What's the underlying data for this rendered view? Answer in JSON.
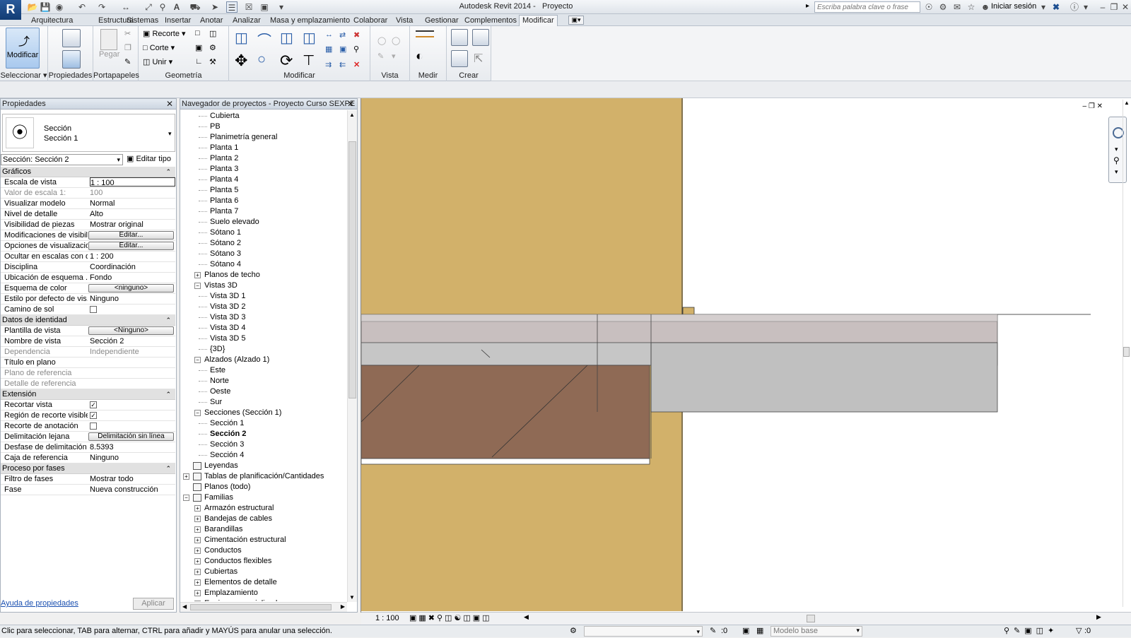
{
  "app": {
    "title": "Autodesk Revit 2014 -",
    "project": "Proyecto",
    "search_placeholder": "Escriba palabra clave o frase",
    "login": "Iniciar sesión"
  },
  "tabs": [
    "Arquitectura",
    "Estructura",
    "Sistemas",
    "Insertar",
    "Anotar",
    "Analizar",
    "Masa y emplazamiento",
    "Colaborar",
    "Vista",
    "Gestionar",
    "Complementos",
    "Modificar"
  ],
  "ribbon": {
    "modify_label": "Modificar",
    "paste_label": "Pegar",
    "cut_label": "Recorte",
    "corte_label": "Corte",
    "join_label": "Unir",
    "panels": [
      "Seleccionar",
      "Propiedades",
      "Portapapeles",
      "Geometría",
      "Modificar",
      "Vista",
      "Medir",
      "Crear"
    ]
  },
  "properties": {
    "title": "Propiedades",
    "type_name": "Sección",
    "type_sub": "Sección 1",
    "instance": "Sección: Sección 2",
    "edit_type": "Editar tipo",
    "categories": {
      "graphics": "Gráficos",
      "identity": "Datos de identidad",
      "extents": "Extensión",
      "phasing": "Proceso por fases"
    },
    "rows": {
      "scale": {
        "k": "Escala de vista",
        "v": "1 : 100"
      },
      "scale_value": {
        "k": "Valor de escala    1:",
        "v": "100"
      },
      "display_model": {
        "k": "Visualizar modelo",
        "v": "Normal"
      },
      "detail_level": {
        "k": "Nivel de detalle",
        "v": "Alto"
      },
      "parts": {
        "k": "Visibilidad de piezas",
        "v": "Mostrar original"
      },
      "vg": {
        "k": "Modificaciones de visibili...",
        "v": "Editar..."
      },
      "graphic_opts": {
        "k": "Opciones de visualizació...",
        "v": "Editar..."
      },
      "hide_scale": {
        "k": "Ocultar en escalas con d...",
        "v": "1 : 200"
      },
      "discipline": {
        "k": "Disciplina",
        "v": "Coordinación"
      },
      "color_loc": {
        "k": "Ubicación de esquema ...",
        "v": "Fondo"
      },
      "color_scheme": {
        "k": "Esquema de color",
        "v": "<ninguno>"
      },
      "analysis": {
        "k": "Estilo por defecto de vis...",
        "v": "Ninguno"
      },
      "sun_path": {
        "k": "Camino de sol",
        "v": ""
      },
      "template": {
        "k": "Plantilla de vista",
        "v": "<Ninguno>"
      },
      "view_name": {
        "k": "Nombre de vista",
        "v": "Sección 2"
      },
      "dependency": {
        "k": "Dependencia",
        "v": "Independiente"
      },
      "title_on_sheet": {
        "k": "Título en plano",
        "v": ""
      },
      "ref_sheet": {
        "k": "Plano de referencia",
        "v": ""
      },
      "ref_detail": {
        "k": "Detalle de referencia",
        "v": ""
      },
      "crop_view": {
        "k": "Recortar vista",
        "v": ""
      },
      "crop_visible": {
        "k": "Región de recorte visible",
        "v": ""
      },
      "annot_crop": {
        "k": "Recorte de anotación",
        "v": ""
      },
      "far_clip": {
        "k": "Delimitación lejana",
        "v": "Delimitación sin línea"
      },
      "far_offset": {
        "k": "Desfase de delimitación ...",
        "v": "8.5393"
      },
      "scope_box": {
        "k": "Caja de referencia",
        "v": "Ninguno"
      },
      "phase_filter": {
        "k": "Filtro de fases",
        "v": "Mostrar todo"
      },
      "phase": {
        "k": "Fase",
        "v": "Nueva construcción"
      }
    },
    "help": "Ayuda de propiedades",
    "apply": "Aplicar"
  },
  "browser": {
    "title": "Navegador de proyectos - Proyecto Curso SEXPE",
    "items": [
      {
        "label": "Cubierta",
        "lvl": 2
      },
      {
        "label": "PB",
        "lvl": 2
      },
      {
        "label": "Planimetría general",
        "lvl": 2
      },
      {
        "label": "Planta 1",
        "lvl": 2
      },
      {
        "label": "Planta 2",
        "lvl": 2
      },
      {
        "label": "Planta 3",
        "lvl": 2
      },
      {
        "label": "Planta 4",
        "lvl": 2
      },
      {
        "label": "Planta 5",
        "lvl": 2
      },
      {
        "label": "Planta 6",
        "lvl": 2
      },
      {
        "label": "Planta 7",
        "lvl": 2
      },
      {
        "label": "Suelo elevado",
        "lvl": 2
      },
      {
        "label": "Sótano 1",
        "lvl": 2
      },
      {
        "label": "Sótano 2",
        "lvl": 2
      },
      {
        "label": "Sótano 3",
        "lvl": 2
      },
      {
        "label": "Sótano 4",
        "lvl": 2
      },
      {
        "label": "Planos de techo",
        "lvl": 1,
        "exp": "+"
      },
      {
        "label": "Vistas 3D",
        "lvl": 1,
        "exp": "-"
      },
      {
        "label": "Vista 3D 1",
        "lvl": 2
      },
      {
        "label": "Vista 3D 2",
        "lvl": 2
      },
      {
        "label": "Vista 3D 3",
        "lvl": 2
      },
      {
        "label": "Vista 3D 4",
        "lvl": 2
      },
      {
        "label": "Vista 3D 5",
        "lvl": 2
      },
      {
        "label": "{3D}",
        "lvl": 2
      },
      {
        "label": "Alzados (Alzado 1)",
        "lvl": 1,
        "exp": "-"
      },
      {
        "label": "Este",
        "lvl": 2
      },
      {
        "label": "Norte",
        "lvl": 2
      },
      {
        "label": "Oeste",
        "lvl": 2
      },
      {
        "label": "Sur",
        "lvl": 2
      },
      {
        "label": "Secciones (Sección  1)",
        "lvl": 1,
        "exp": "-"
      },
      {
        "label": "Sección 1",
        "lvl": 2
      },
      {
        "label": "Sección 2",
        "lvl": 2,
        "bold": true
      },
      {
        "label": "Sección 3",
        "lvl": 2
      },
      {
        "label": "Sección 4",
        "lvl": 2
      },
      {
        "label": "Leyendas",
        "lvl": 0,
        "icon": true
      },
      {
        "label": "Tablas de planificación/Cantidades",
        "lvl": 0,
        "exp": "+",
        "icon": true
      },
      {
        "label": "Planos (todo)",
        "lvl": 0,
        "icon": true
      },
      {
        "label": "Familias",
        "lvl": 0,
        "exp": "-",
        "icon": true
      },
      {
        "label": "Armazón estructural",
        "lvl": 1,
        "exp": "+"
      },
      {
        "label": "Bandejas de cables",
        "lvl": 1,
        "exp": "+"
      },
      {
        "label": "Barandillas",
        "lvl": 1,
        "exp": "+"
      },
      {
        "label": "Cimentación estructural",
        "lvl": 1,
        "exp": "+"
      },
      {
        "label": "Conductos",
        "lvl": 1,
        "exp": "+"
      },
      {
        "label": "Conductos flexibles",
        "lvl": 1,
        "exp": "+"
      },
      {
        "label": "Cubiertas",
        "lvl": 1,
        "exp": "+"
      },
      {
        "label": "Elementos de detalle",
        "lvl": 1,
        "exp": "+"
      },
      {
        "label": "Emplazamiento",
        "lvl": 1,
        "exp": "+"
      },
      {
        "label": "Equipos especializados",
        "lvl": 1,
        "exp": "+"
      }
    ]
  },
  "view": {
    "scale": "1 : 100"
  },
  "status": {
    "hint": "Clic para seleccionar, TAB para alternar, CTRL para añadir y MAYÚS para anular una selección.",
    "zero": ":0",
    "model": "Modelo base",
    "filter_count": ":0"
  },
  "colors": {
    "wall": "#d2b16a",
    "floor": "#c8bfbf",
    "earth": "#8f6a55",
    "slab": "#c0c0c0"
  }
}
